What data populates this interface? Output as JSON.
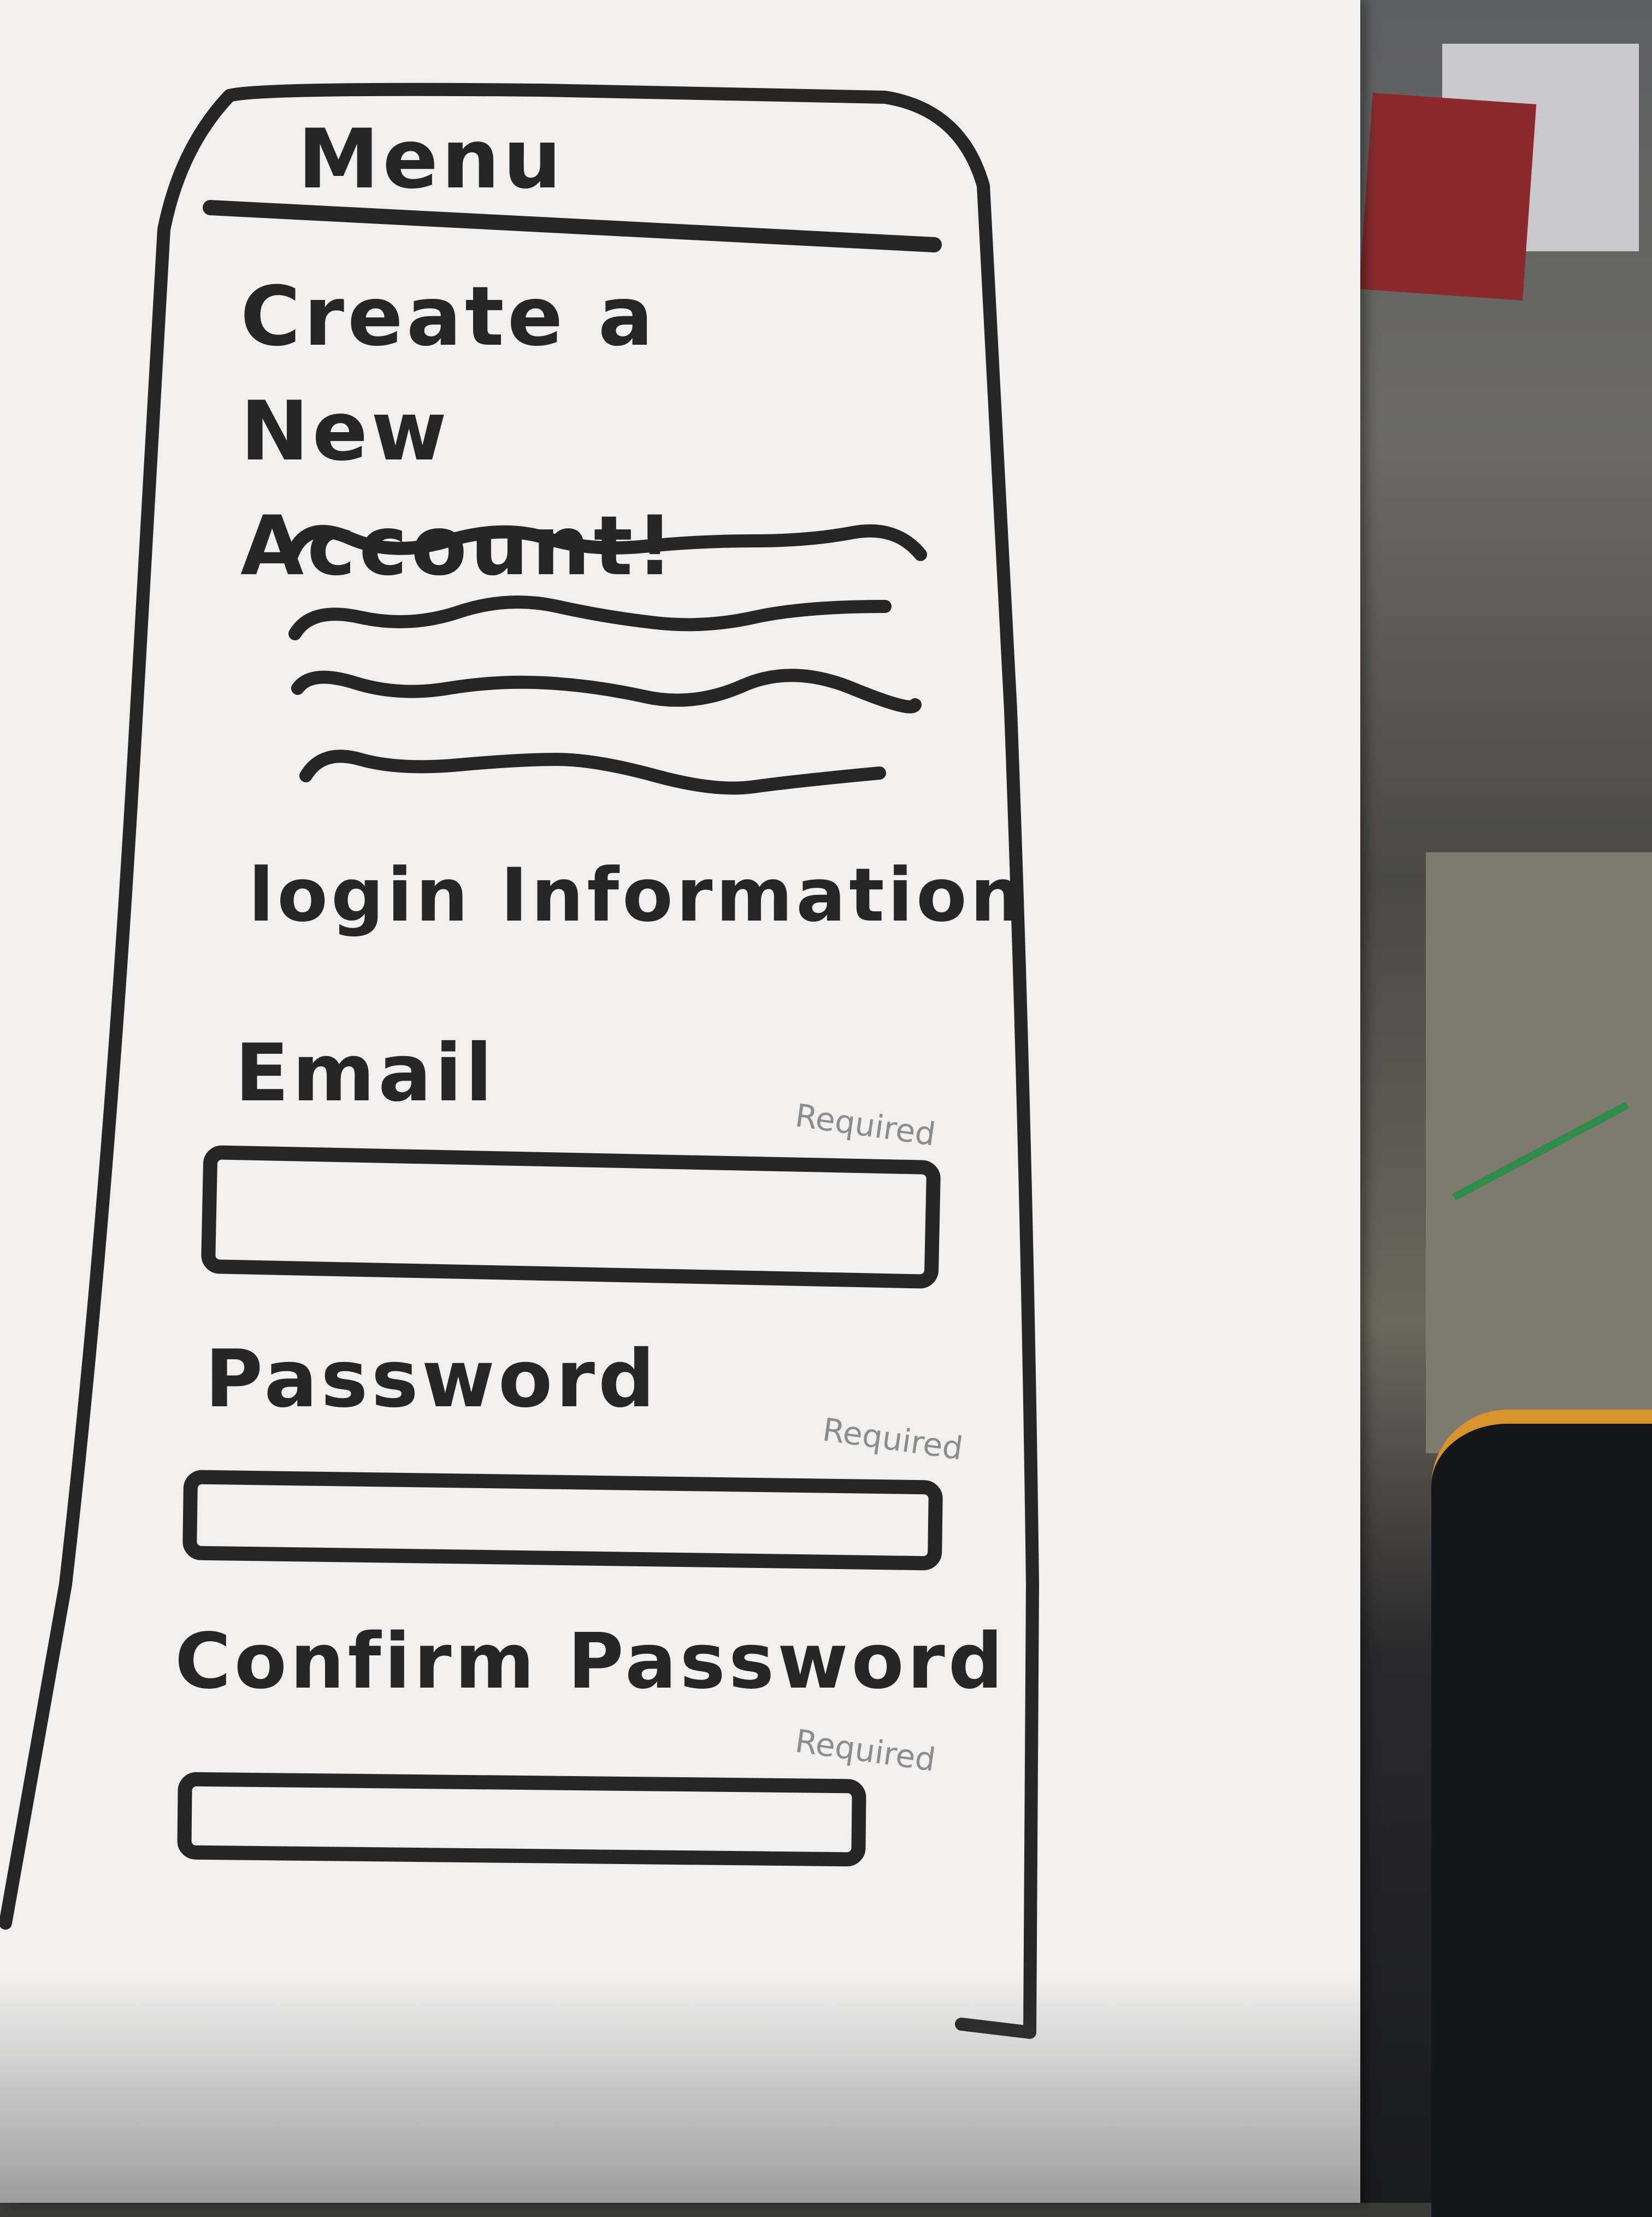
{
  "menu": {
    "title": "Menu"
  },
  "main": {
    "heading": "Create a New Account!",
    "section_title": "login Information"
  },
  "form": {
    "email": {
      "label": "Email",
      "value": "",
      "required_note": "Required"
    },
    "password": {
      "label": "Password",
      "value": "",
      "required_note": "Required"
    },
    "confirm_password": {
      "label": "Confirm Password",
      "value": "",
      "required_note": "Required"
    }
  },
  "colors": {
    "ink": "#262626",
    "paper": "#f1f0ef",
    "pencil": "#8c8c8c"
  }
}
